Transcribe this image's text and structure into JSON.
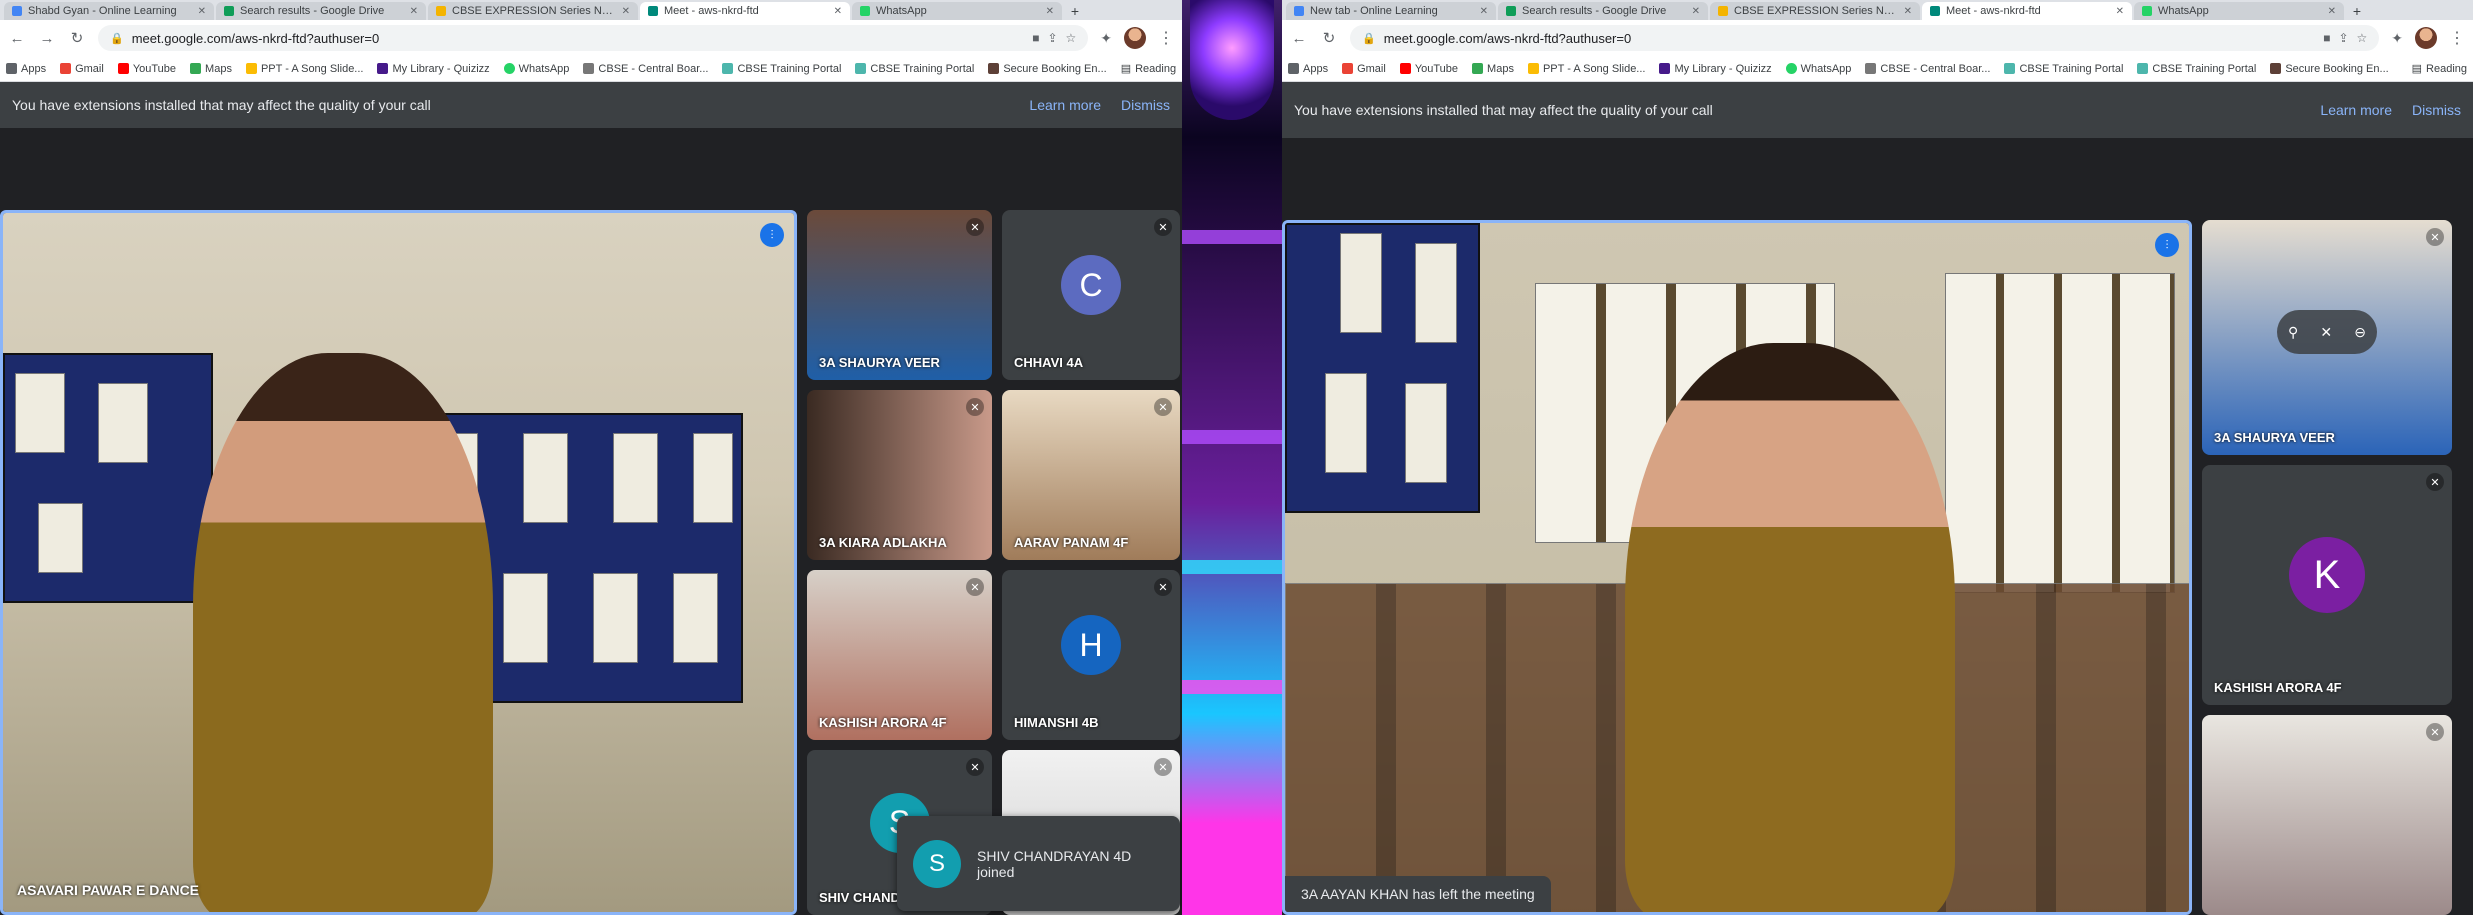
{
  "left": {
    "tabs": [
      {
        "title": "Shabd Gyan - Online Learning"
      },
      {
        "title": "Search results - Google Drive"
      },
      {
        "title": "CBSE EXPRESSION Series Natu..."
      },
      {
        "title": "Meet - aws-nkrd-ftd",
        "active": true
      },
      {
        "title": "WhatsApp"
      }
    ],
    "url": "meet.google.com/aws-nkrd-ftd?authuser=0",
    "bookmarks": [
      "Apps",
      "Gmail",
      "YouTube",
      "Maps",
      "PPT - A Song Slide...",
      "My Library - Quizizz",
      "WhatsApp",
      "CBSE - Central Boar...",
      "CBSE Training Portal",
      "CBSE Training Portal",
      "Secure Booking En..."
    ],
    "reading_list": "Reading",
    "notice": {
      "message": "You have extensions installed that may affect the quality of your call",
      "learn_more": "Learn more",
      "dismiss": "Dismiss"
    },
    "main_speaker": "ASAVARI PAWAR E DANCE",
    "participants": [
      {
        "name": "3A SHAURYA VEER",
        "video": true
      },
      {
        "name": "CHHAVI 4A",
        "initial": "C",
        "color": "#5c6bc0"
      },
      {
        "name": "3A KIARA ADLAKHA",
        "video": true
      },
      {
        "name": "AARAV PANAM 4F",
        "video": true
      },
      {
        "name": "KASHISH ARORA 4F",
        "video": true
      },
      {
        "name": "HIMANSHI 4B",
        "initial": "H",
        "color": "#1565c0"
      },
      {
        "name": "SHIV CHANDRA",
        "initial": "S",
        "color": "#129eaf"
      }
    ],
    "toast": {
      "initial": "S",
      "line1": "SHIV CHANDRAYAN 4D",
      "line2": "joined"
    }
  },
  "right": {
    "tabs": [
      {
        "title": "New tab - Online Learning"
      },
      {
        "title": "Search results - Google Drive"
      },
      {
        "title": "CBSE EXPRESSION Series Natu..."
      },
      {
        "title": "Meet - aws-nkrd-ftd",
        "active": true
      },
      {
        "title": "WhatsApp"
      }
    ],
    "url": "meet.google.com/aws-nkrd-ftd?authuser=0",
    "bookmarks": [
      "Apps",
      "Gmail",
      "YouTube",
      "Maps",
      "PPT - A Song Slide...",
      "My Library - Quizizz",
      "WhatsApp",
      "CBSE - Central Boar...",
      "CBSE Training Portal",
      "CBSE Training Portal",
      "Secure Booking En..."
    ],
    "reading_list": "Reading",
    "notice": {
      "message": "You have extensions installed that may affect the quality of your call",
      "learn_more": "Learn more",
      "dismiss": "Dismiss"
    },
    "participants": [
      {
        "name": "3A SHAURYA VEER",
        "video": true
      },
      {
        "name": "KASHISH ARORA 4F",
        "initial": "K",
        "color": "#7b1fa2"
      },
      {
        "name": "",
        "video": true
      }
    ],
    "left_meeting": "3A AAYAN KHAN has left the meeting"
  },
  "colors": {
    "accent": "#8ab4f8",
    "meet_bg": "#202124",
    "tile_bg": "#3c4043",
    "speaking": "#1a73e8"
  }
}
